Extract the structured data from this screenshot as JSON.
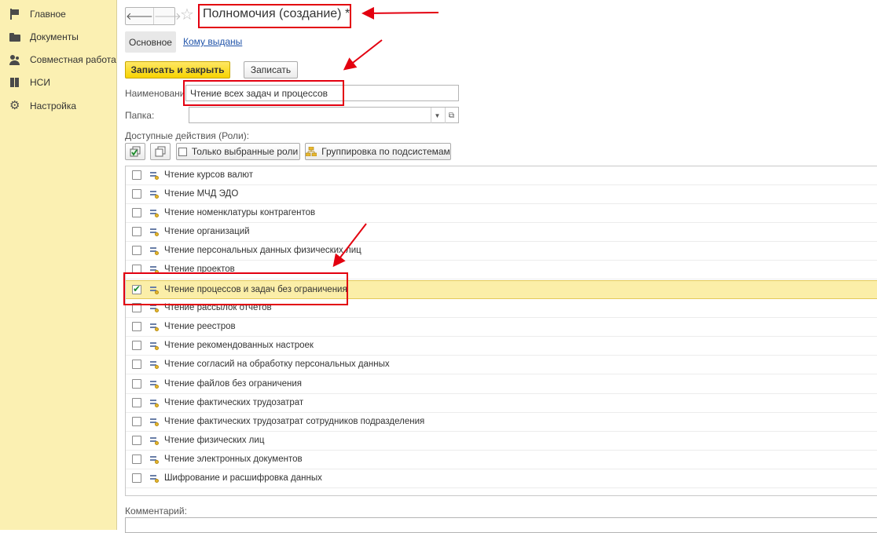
{
  "sidebar": {
    "items": [
      {
        "label": "Главное",
        "icon": "flag-icon"
      },
      {
        "label": "Документы",
        "icon": "folder-icon"
      },
      {
        "label": "Совместная работа",
        "icon": "users-icon"
      },
      {
        "label": "НСИ",
        "icon": "book-icon"
      },
      {
        "label": "Настройка",
        "icon": "gear-icon"
      }
    ],
    "background": "#fbf0b2"
  },
  "header": {
    "back": "🡐",
    "forward": "🡒",
    "star": "☆",
    "title": "Полномочия (создание) *"
  },
  "tabs": {
    "active": "Основное",
    "link": "Кому выданы"
  },
  "toolbar": {
    "save_close": "Записать и закрыть",
    "save": "Записать"
  },
  "form": {
    "name_label": "Наименование:",
    "name_value": "Чтение всех задач и процессов",
    "folder_label": "Папка:",
    "folder_value": "",
    "roles_label": "Доступные действия (Роли):",
    "dropdown_glyph": "▼",
    "open_glyph": "⧉",
    "comment_label": "Комментарий:"
  },
  "roles_toolbar": {
    "only_selected": "Только выбранные роли",
    "group_by": "Группировка по подсистемам"
  },
  "roles": [
    {
      "label": "Чтение курсов валют",
      "checked": false
    },
    {
      "label": "Чтение МЧД ЭДО",
      "checked": false
    },
    {
      "label": "Чтение номенклатуры контрагентов",
      "checked": false
    },
    {
      "label": "Чтение организаций",
      "checked": false
    },
    {
      "label": "Чтение персональных данных физических лиц",
      "checked": false
    },
    {
      "label": "Чтение проектов",
      "checked": false
    },
    {
      "label": "Чтение процессов и задач без ограничения",
      "checked": true
    },
    {
      "label": "Чтение рассылок отчетов",
      "checked": false
    },
    {
      "label": "Чтение реестров",
      "checked": false
    },
    {
      "label": "Чтение рекомендованных настроек",
      "checked": false
    },
    {
      "label": "Чтение согласий на обработку персональных данных",
      "checked": false
    },
    {
      "label": "Чтение файлов без ограничения",
      "checked": false
    },
    {
      "label": "Чтение фактических трудозатрат",
      "checked": false
    },
    {
      "label": "Чтение фактических трудозатрат сотрудников подразделения",
      "checked": false
    },
    {
      "label": "Чтение физических лиц",
      "checked": false
    },
    {
      "label": "Чтение электронных документов",
      "checked": false
    },
    {
      "label": "Шифрование и расшифровка данных",
      "checked": false
    }
  ],
  "colors": {
    "highlight": "#e3000f",
    "primary_button": "#f7d300",
    "selected_row": "#fbeea8",
    "link": "#2255aa"
  }
}
